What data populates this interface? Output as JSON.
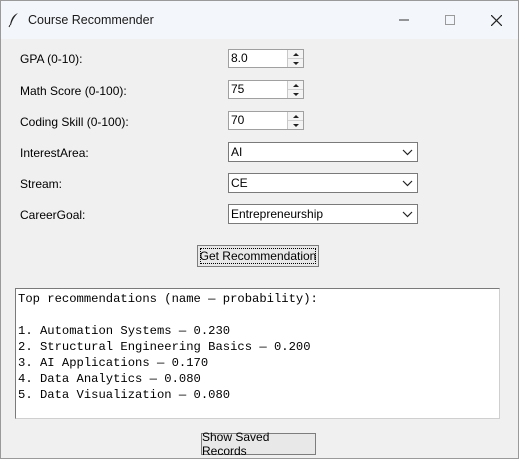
{
  "window": {
    "title": "Course Recommender"
  },
  "form": {
    "gpa": {
      "label": "GPA (0-10):",
      "value": "8.0"
    },
    "math": {
      "label": "Math Score (0-100):",
      "value": "75"
    },
    "coding": {
      "label": "Coding Skill (0-100):",
      "value": "70"
    },
    "interest": {
      "label": "InterestArea:",
      "value": "AI"
    },
    "stream": {
      "label": "Stream:",
      "value": "CE"
    },
    "career": {
      "label": "CareerGoal:",
      "value": "Entrepreneurship"
    }
  },
  "buttons": {
    "get_recommendation": "Get Recommendation",
    "show_saved_records": "Show Saved Records"
  },
  "output": {
    "header": "Top recommendations (name — probability):",
    "lines": [
      "1. Automation Systems — 0.230",
      "2. Structural Engineering Basics — 0.200",
      "3. AI Applications — 0.170",
      "4. Data Analytics — 0.080",
      "5. Data Visualization — 0.080"
    ]
  }
}
